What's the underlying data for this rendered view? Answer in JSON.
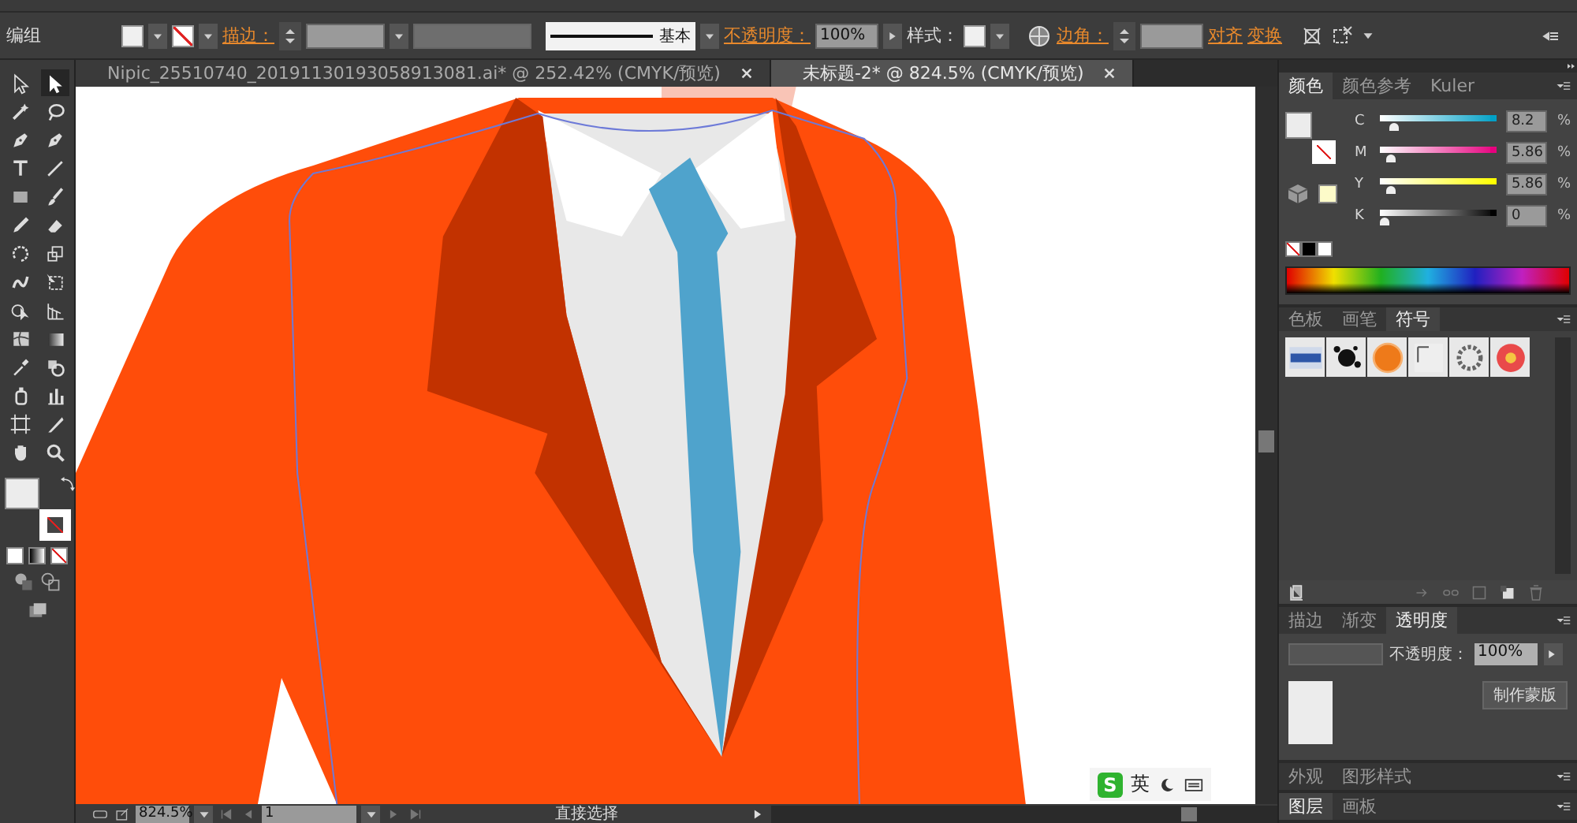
{
  "control_bar": {
    "selection": "编组",
    "stroke_label": "描边：",
    "stroke_profile": "基本",
    "opacity_label": "不透明度：",
    "opacity_value": "100%",
    "style_label": "样式：",
    "corner_label": "边角：",
    "align_link": "对齐",
    "transform_link": "变换"
  },
  "document_tabs": [
    {
      "title": "Nipic_25510740_20191130193058913081.ai* @ 252.42% (CMYK/预览)",
      "selected": false
    },
    {
      "title": "未标题-2* @ 824.5% (CMYK/预览)",
      "selected": true
    }
  ],
  "tools": [
    {
      "kind": "select",
      "selected": false
    },
    {
      "kind": "direct",
      "selected": true
    },
    {
      "kind": "wand",
      "selected": false
    },
    {
      "kind": "lasso",
      "selected": false
    },
    {
      "kind": "pen",
      "selected": false
    },
    {
      "kind": "pen",
      "selected": false
    },
    {
      "kind": "type",
      "selected": false
    },
    {
      "kind": "line",
      "selected": false
    },
    {
      "kind": "rect",
      "selected": false
    },
    {
      "kind": "brush",
      "selected": false
    },
    {
      "kind": "pencil",
      "selected": false
    },
    {
      "kind": "eraser",
      "selected": false
    },
    {
      "kind": "rotate",
      "selected": false
    },
    {
      "kind": "scale",
      "selected": false
    },
    {
      "kind": "warp",
      "selected": false
    },
    {
      "kind": "free",
      "selected": false
    },
    {
      "kind": "shape",
      "selected": false
    },
    {
      "kind": "grid",
      "selected": false
    },
    {
      "kind": "mesh",
      "selected": false
    },
    {
      "kind": "gradient",
      "selected": false
    },
    {
      "kind": "dropper",
      "selected": false
    },
    {
      "kind": "blend",
      "selected": false
    },
    {
      "kind": "spray",
      "selected": false
    },
    {
      "kind": "graph",
      "selected": false
    },
    {
      "kind": "artboard",
      "selected": false
    },
    {
      "kind": "knife",
      "selected": false
    },
    {
      "kind": "hand",
      "selected": false
    },
    {
      "kind": "zoom",
      "selected": false
    }
  ],
  "color_panel": {
    "tabs": [
      {
        "label": "颜色",
        "selected": true
      },
      {
        "label": "颜色参考",
        "selected": false
      },
      {
        "label": "Kuler",
        "selected": false
      }
    ],
    "channels": [
      {
        "name": "C",
        "color": "#00a0c6",
        "level": 0.082,
        "value": "8.2",
        "unit": "%"
      },
      {
        "name": "M",
        "color": "#e6007e",
        "level": 0.0586,
        "value": "5.86",
        "unit": "%"
      },
      {
        "name": "Y",
        "color": "#ffff00",
        "level": 0.0586,
        "value": "5.86",
        "unit": "%"
      },
      {
        "name": "K",
        "color": "#000000",
        "level": 0,
        "value": "0",
        "unit": "%"
      }
    ]
  },
  "symbols_panel": {
    "tabs": [
      {
        "label": "色板",
        "selected": false
      },
      {
        "label": "画笔",
        "selected": false
      },
      {
        "label": "符号",
        "selected": true
      }
    ]
  },
  "transparency_panel": {
    "tabs": [
      {
        "label": "描边",
        "selected": false
      },
      {
        "label": "渐变",
        "selected": false
      },
      {
        "label": "透明度",
        "selected": true
      }
    ],
    "opacity_label": "不透明度：",
    "opacity_value": "100%",
    "mask_button": "制作蒙版"
  },
  "appearance_tabs": [
    {
      "label": "外观",
      "selected": false
    },
    {
      "label": "图形样式",
      "selected": false
    }
  ],
  "layers_tabs": [
    {
      "label": "图层",
      "selected": true
    },
    {
      "label": "画板",
      "selected": false
    }
  ],
  "ime_bar": {
    "logo": "S",
    "label": "英"
  },
  "status_bar": {
    "zoom": "824.5%",
    "page": "1",
    "tool": "直接选择"
  }
}
